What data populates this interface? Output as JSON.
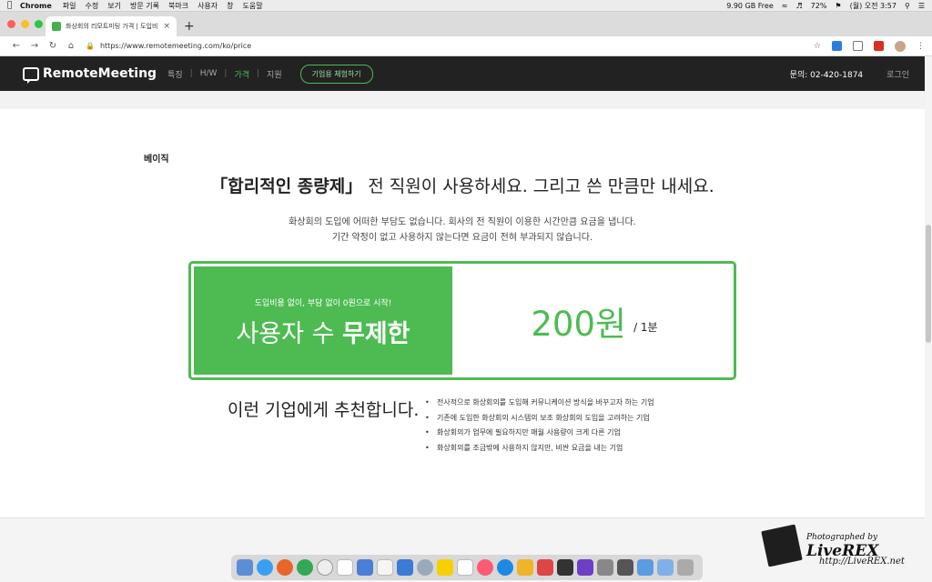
{
  "menubar": {
    "app": "Chrome",
    "items": [
      "파일",
      "수정",
      "보기",
      "방문 기록",
      "북마크",
      "사용자",
      "창",
      "도움말"
    ],
    "status": {
      "disk": "9.90 GB Free",
      "battery": "72%",
      "clock": "(월) 오전 3:57"
    }
  },
  "browser": {
    "tab_title": "화상회의 리모트미팅 가격 | 도입비 2…",
    "url": "https://www.remotemeeting.com/ko/price"
  },
  "site": {
    "logo": "RemoteMeeting",
    "nav": [
      "특징",
      "H/W",
      "가격",
      "지원"
    ],
    "nav_active": "가격",
    "trial_button": "기업용 체험하기",
    "contact": "문의: 02-420-1874",
    "login": "로그인",
    "accent_color": "#4dbb52"
  },
  "plan": {
    "label": "베이직",
    "headline_bold": "「합리적인 종량제」",
    "headline_rest": " 전 직원이 사용하세요. 그리고 쓴 만큼만 내세요.",
    "desc_line1": "화상회의 도입에 어떠한 부담도 없습니다. 회사의 전 직원이 이용한 시간만큼 요금을 냅니다.",
    "desc_line2": "기간 약정이 없고 사용하지 않는다면 요금이 전혀 부과되지 않습니다.",
    "box_sub": "도입비용 없이, 부담 없이 0원으로 시작!",
    "box_main_prefix": "사용자 수 ",
    "box_main_bold": "무제한",
    "price": "200원",
    "price_unit": "/ 1분"
  },
  "recommend": {
    "title": "이런 기업에게 추천합니다.",
    "items": [
      "전사적으로 화상회의를 도입해 커뮤니케이션 방식을 바꾸고자 하는 기업",
      "기존에 도입한 화상회의 시스템의 보조 화상회의 도입을 고려하는 기업",
      "화상회의가 업무에 필요하지만 매월 사용량이 크게 다른 기업",
      "화상회의를 조금밖에 사용하지 않지만, 비싼 요금을 내는 기업"
    ]
  },
  "watermark": {
    "line1": "Photographed by",
    "brand": "LiveREX",
    "url": "http://LiveREX.net"
  }
}
